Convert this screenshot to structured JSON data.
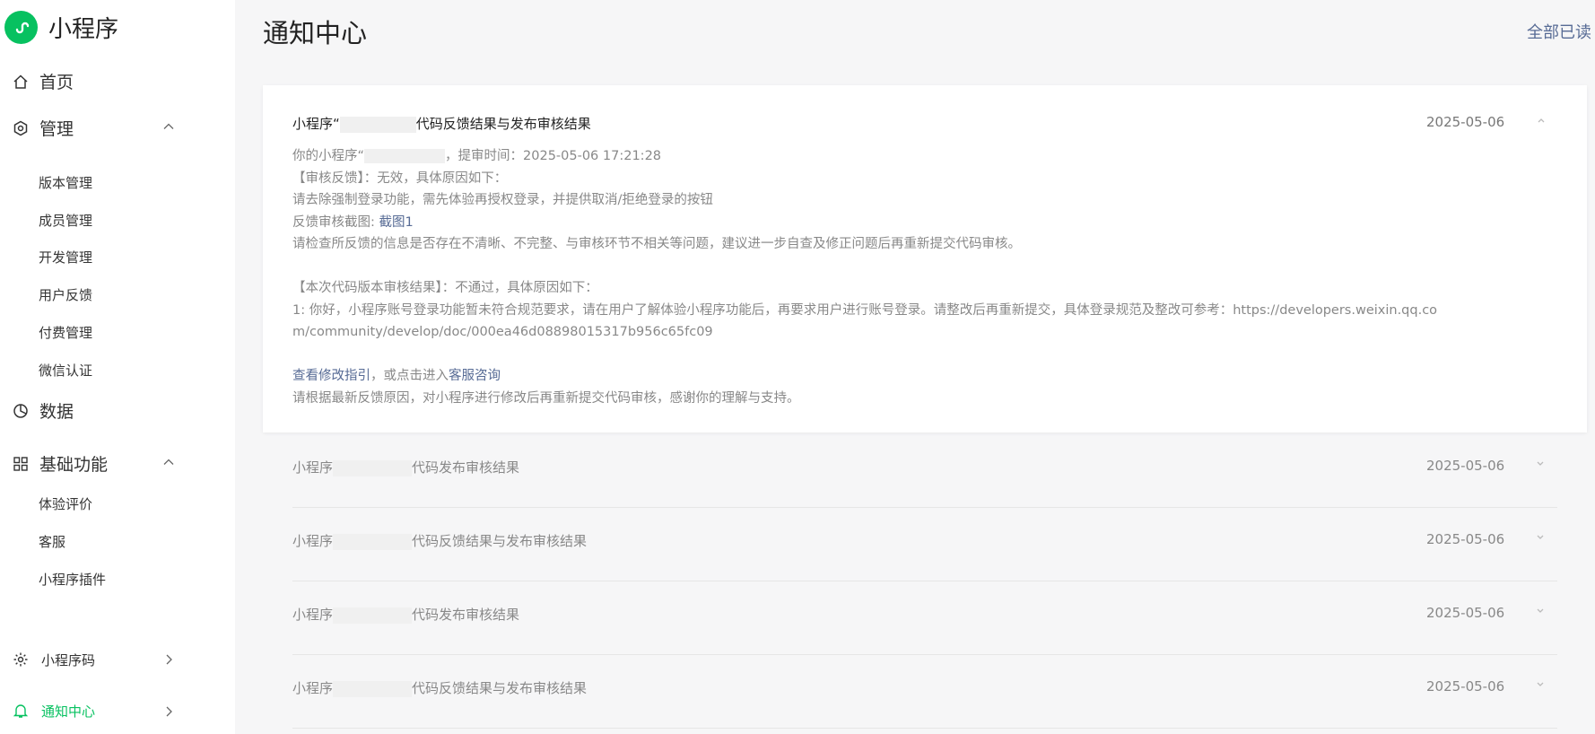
{
  "app": {
    "name": "小程序"
  },
  "sidebar": {
    "home": "首页",
    "manage": {
      "label": "管理",
      "items": [
        "版本管理",
        "成员管理",
        "开发管理",
        "用户反馈",
        "付费管理",
        "微信认证"
      ]
    },
    "data": "数据",
    "basic": {
      "label": "基础功能",
      "items": [
        "体验评价",
        "客服",
        "小程序插件"
      ]
    },
    "qrcode": "小程序码",
    "notify": "通知中心"
  },
  "header": {
    "title": "通知中心",
    "mark_all": "全部已读"
  },
  "expanded": {
    "title_prefix": "小程序“",
    "title_suffix": "代码反馈结果与发布审核结果",
    "date": "2025-05-06",
    "line1_prefix": "你的小程序“",
    "line1_suffix": "，提审时间：2025-05-06 17:21:28",
    "line2": "【审核反馈】：无效，具体原因如下：",
    "line3": "请去除强制登录功能，需先体验再授权登录，并提供取消/拒绝登录的按钮",
    "line4_label": "反馈审核截图: ",
    "line4_link": "截图1",
    "line5": "请检查所反馈的信息是否存在不清晰、不完整、与审核环节不相关等问题，建议进一步自查及修正问题后再重新提交代码审核。",
    "line6": "【本次代码版本审核结果】：不通过，具体原因如下：",
    "line7": "1: 你好，小程序账号登录功能暂未符合规范要求，请在用户了解体验小程序功能后，再要求用户进行账号登录。请整改后再重新提交，具体登录规范及整改可参考：https://developers.weixin.qq.co",
    "line8": "m/community/develop/doc/000ea46d08898015317b956c65fc09",
    "guide_link": "查看修改指引",
    "guide_mid": "，或点击进入",
    "service_link": "客服咨询",
    "line10": "请根据最新反馈原因，对小程序进行修改后再重新提交代码审核，感谢你的理解与支持。"
  },
  "rows": [
    {
      "prefix": "小程序",
      "suffix": "代码发布审核结果",
      "date": "2025-05-06"
    },
    {
      "prefix": "小程序",
      "suffix": "代码反馈结果与发布审核结果",
      "date": "2025-05-06"
    },
    {
      "prefix": "小程序",
      "suffix": "代码发布审核结果",
      "date": "2025-05-06"
    },
    {
      "prefix": "小程序",
      "suffix": "代码反馈结果与发布审核结果",
      "date": "2025-05-06"
    }
  ],
  "colors": {
    "brand": "#07c160",
    "link": "#576b95"
  },
  "icons": [
    "miniprogram-logo-icon",
    "home-icon",
    "manage-icon",
    "chevron-up-icon",
    "data-icon",
    "grid-icon",
    "qrcode-icon",
    "bell-icon",
    "chevron-right-icon",
    "chevron-down-icon"
  ]
}
